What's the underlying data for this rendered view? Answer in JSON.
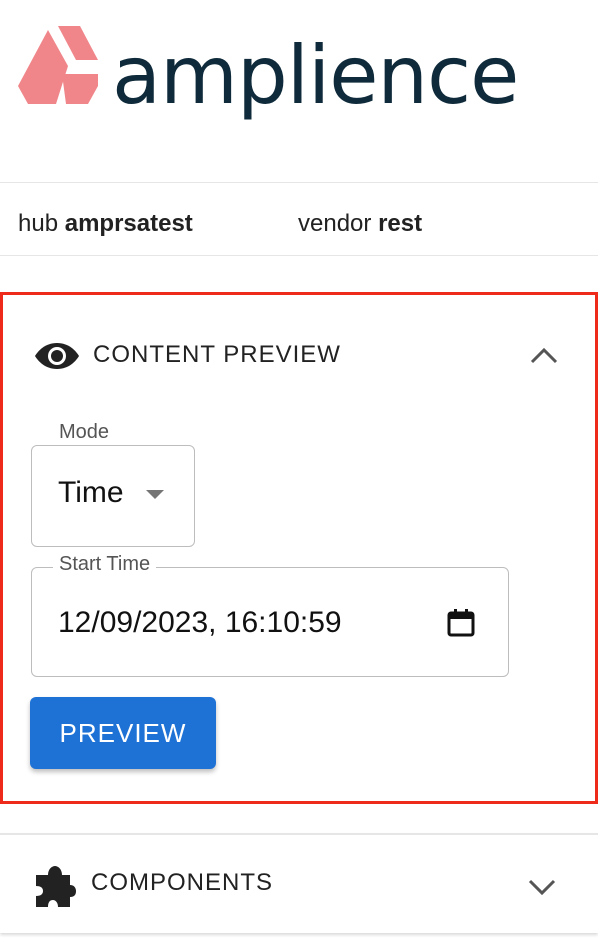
{
  "brand": {
    "name": "amplience",
    "logo_color": "#f0868a",
    "text_color": "#0f2a3a"
  },
  "info": {
    "hub_prefix": "hub",
    "hub_value": "amprsatest",
    "vendor_prefix": "vendor",
    "vendor_value": "rest"
  },
  "content_preview": {
    "title": "CONTENT PREVIEW",
    "icon": "eye-icon",
    "expanded": true,
    "mode": {
      "label": "Mode",
      "value": "Time"
    },
    "start_time": {
      "label": "Start Time",
      "value": "12/09/2023, 16:10:59"
    },
    "button_label": "PREVIEW",
    "highlight_color": "#ee2a1b",
    "button_color": "#1e72d6"
  },
  "components": {
    "title": "COMPONENTS",
    "icon": "puzzle-icon",
    "expanded": false
  }
}
